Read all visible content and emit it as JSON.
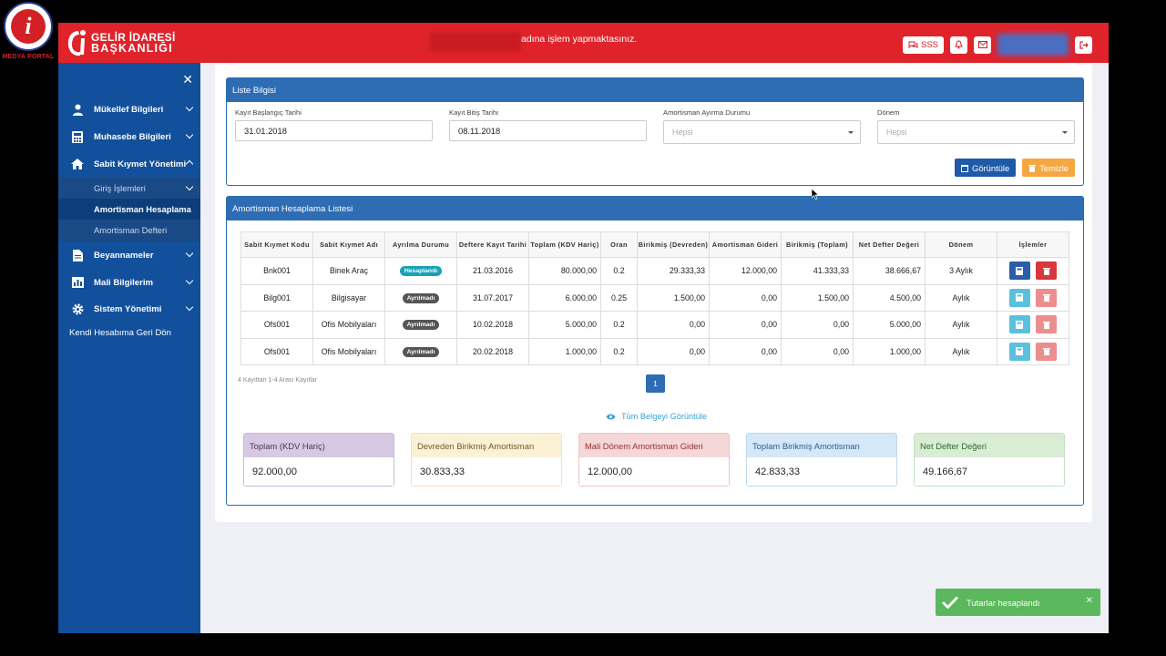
{
  "corner_brand": {
    "caption": "MEDYA PORTAL"
  },
  "header": {
    "logo_line1": "GELİR İDARESİ",
    "logo_line2": "BAŞKANLIĞI",
    "notice": "adına işlem yapmaktasınız.",
    "sss_label": "SSS",
    "brand_color": "#e0232b"
  },
  "sidebar": {
    "items": [
      {
        "label": "Mükellef Bilgileri",
        "icon": "user-icon"
      },
      {
        "label": "Muhasebe Bilgileri",
        "icon": "calculator-icon"
      },
      {
        "label": "Sabit Kıymet Yönetimi",
        "icon": "home-icon"
      },
      {
        "label": "Beyannameler",
        "icon": "document-icon"
      },
      {
        "label": "Mali Bilgilerim",
        "icon": "bar-chart-icon"
      },
      {
        "label": "Sistem Yönetimi",
        "icon": "gear-icon"
      }
    ],
    "subitems": [
      {
        "label": "Giriş İşlemleri"
      },
      {
        "label": "Amortisman Hesaplama",
        "active": true
      },
      {
        "label": "Amortisman Defteri"
      }
    ],
    "back_link": "Kendi Hesabıma Geri Dön"
  },
  "filter_panel": {
    "title": "Liste Bilgisi",
    "fields": [
      {
        "label": "Kayıt Başlangıç Tarihi",
        "value": "31.01.2018"
      },
      {
        "label": "Kayıt Bitiş Tarihi",
        "value": "08.11.2018"
      },
      {
        "label": "Amortisman Ayırma Durumu",
        "placeholder": "Hepsi"
      },
      {
        "label": "Dönem",
        "placeholder": "Hepsi"
      }
    ],
    "view_button": "Görüntüle",
    "clear_button": "Temizle"
  },
  "list_panel": {
    "title": "Amortisman Hesaplama Listesi",
    "columns": [
      "Sabit Kıymet Kodu",
      "Sabit Kıymet Adı",
      "Ayrılma Durumu",
      "Deftere Kayıt Tarihi",
      "Toplam (KDV Hariç)",
      "Oran",
      "Birikmiş (Devreden)",
      "Amortisman Gideri",
      "Birikmiş (Toplam)",
      "Net Defter Değeri",
      "Dönem",
      "İşlemler"
    ],
    "rows": [
      {
        "code": "Bnk001",
        "name": "Binek Araç",
        "status": "Hesaplandı",
        "date": "21.03.2016",
        "total": "80.000,00",
        "rate": "0.2",
        "carried": "29.333,33",
        "expense": "12.000,00",
        "accum": "41.333,33",
        "net": "38.666,67",
        "period": "3 Aylık"
      },
      {
        "code": "Bilg001",
        "name": "Bilgisayar",
        "status": "Ayrılmadı",
        "date": "31.07.2017",
        "total": "6.000,00",
        "rate": "0.25",
        "carried": "1.500,00",
        "expense": "0,00",
        "accum": "1.500,00",
        "net": "4.500,00",
        "period": "Aylık"
      },
      {
        "code": "Ofs001",
        "name": "Ofis Mobilyaları",
        "status": "Ayrılmadı",
        "date": "10.02.2018",
        "total": "5.000,00",
        "rate": "0.2",
        "carried": "0,00",
        "expense": "0,00",
        "accum": "0,00",
        "net": "5.000,00",
        "period": "Aylık"
      },
      {
        "code": "Ofs001",
        "name": "Ofis Mobilyaları",
        "status": "Ayrılmadı",
        "date": "20.02.2018",
        "total": "1.000,00",
        "rate": "0.2",
        "carried": "0,00",
        "expense": "0,00",
        "accum": "0,00",
        "net": "1.000,00",
        "period": "Aylık"
      }
    ],
    "record_info": "4 Kayıttan 1-4 Arası Kayıtlar",
    "page": "1",
    "view_all": "Tüm Belgeyi Görüntüle"
  },
  "summary_cards": [
    {
      "label": "Toplam (KDV Hariç)",
      "value": "92.000,00"
    },
    {
      "label": "Devreden Birikmiş Amortisman",
      "value": "30.833,33"
    },
    {
      "label": "Mali Dönem Amortisman Gideri",
      "value": "12.000,00"
    },
    {
      "label": "Toplam Birikmiş Amortisman",
      "value": "42.833,33"
    },
    {
      "label": "Net Defter Değeri",
      "value": "49.166,67"
    }
  ],
  "toast": {
    "message": "Tutarlar hesaplandı"
  }
}
